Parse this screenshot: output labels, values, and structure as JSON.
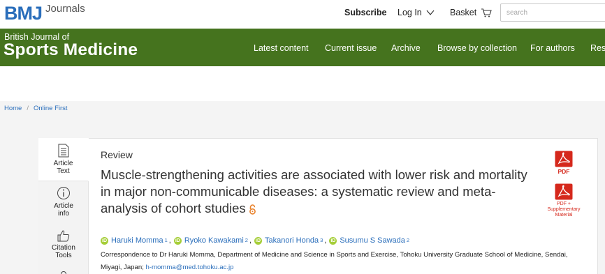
{
  "header": {
    "logo_text": "BMJ",
    "logo_sub": "Journals",
    "subscribe": "Subscribe",
    "login": "Log In",
    "basket": "Basket",
    "search_placeholder": "search"
  },
  "nav": {
    "journal_sub": "British Journal of",
    "journal_main": "Sports Medicine",
    "items": [
      "Latest content",
      "Current issue",
      "Archive",
      "Browse by collection",
      "For authors",
      "Res"
    ],
    "bg_color": "#45731e"
  },
  "breadcrumb": {
    "home": "Home",
    "separator": "/",
    "current": "Online First"
  },
  "tabs": {
    "article_text_1": "Article",
    "article_text_2": "Text",
    "article_info_1": "Article",
    "article_info_2": "info",
    "citation_1": "Citation",
    "citation_2": "Tools"
  },
  "article": {
    "type": "Review",
    "title": "Muscle-strengthening activities are associated with lower risk and mortality in major non-communicable diseases: a systematic review and meta-analysis of cohort studies",
    "open_access_icon": "open-access-lock-icon",
    "authors": [
      {
        "name": "Haruki Momma",
        "aff": "1"
      },
      {
        "name": "Ryoko Kawakami",
        "aff": "2"
      },
      {
        "name": "Takanori Honda",
        "aff": "3"
      },
      {
        "name": "Susumu S Sawada",
        "aff": "2"
      }
    ],
    "author_separator": ",",
    "orcid_glyph": "iD",
    "correspondence": "Correspondence to Dr Haruki Momma, Department of Medicine and Science in Sports and Exercise, Tohoku University Graduate School of Medicine, Sendai, Miyagi, Japan;",
    "email": "h-momma@med.tohoku.ac.jp"
  },
  "downloads": {
    "pdf_label": "PDF",
    "supp_label_1": "PDF +",
    "supp_label_2": "Supplementary",
    "supp_label_3": "Material",
    "color": "#d5281c"
  }
}
